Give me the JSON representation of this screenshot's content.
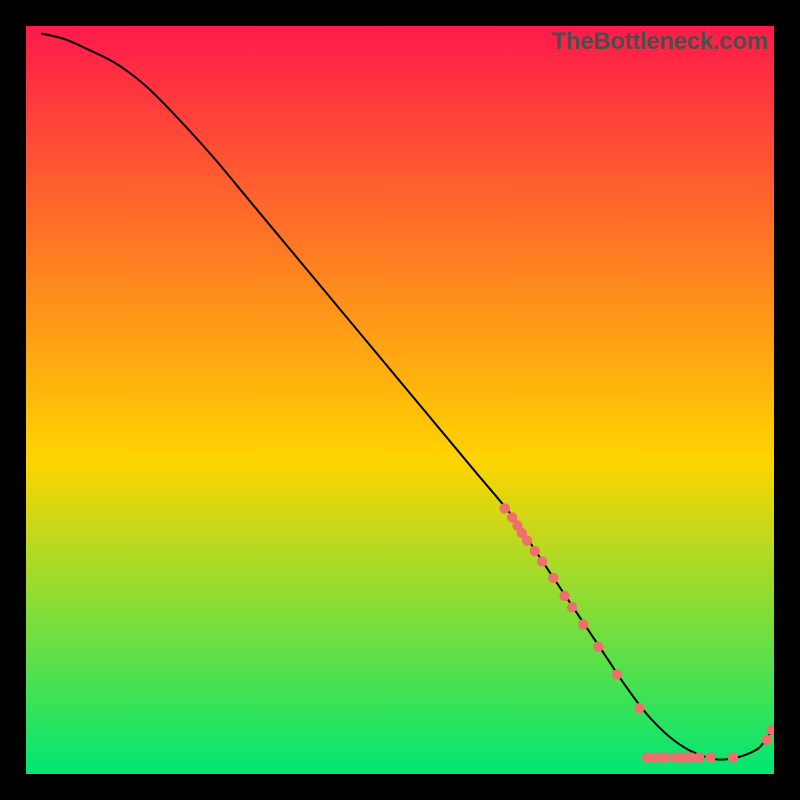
{
  "watermark": "TheBottleneck.com",
  "chart_data": {
    "type": "line",
    "title": "",
    "xlabel": "",
    "ylabel": "",
    "xlim": [
      0,
      100
    ],
    "ylim": [
      0,
      100
    ],
    "gradient_top": "#ff1a4a",
    "gradient_mid": "#ffd400",
    "gradient_bottom": "#00e673",
    "line_color": "#000000",
    "dot_color": "#ef6f6c",
    "series": [
      {
        "name": "curve",
        "x": [
          2,
          5,
          8,
          12,
          16,
          20,
          25,
          30,
          35,
          40,
          45,
          50,
          55,
          60,
          65,
          68,
          70,
          72,
          74,
          76,
          78,
          80,
          83,
          86,
          89,
          92,
          94,
          96,
          98,
          99.5
        ],
        "y": [
          99,
          98.3,
          97,
          95,
          92,
          88,
          82.5,
          76.5,
          70.5,
          64.5,
          58.5,
          52.5,
          46.5,
          40.5,
          34.5,
          30,
          27,
          24,
          21,
          18,
          15,
          12,
          8,
          5,
          3,
          2,
          2,
          2.5,
          3.5,
          5.5
        ]
      }
    ],
    "dots": [
      {
        "x": 64,
        "y": 35.5
      },
      {
        "x": 65,
        "y": 34.3
      },
      {
        "x": 65.7,
        "y": 33.2
      },
      {
        "x": 66.3,
        "y": 32.2
      },
      {
        "x": 67,
        "y": 31.2
      },
      {
        "x": 68,
        "y": 29.8
      },
      {
        "x": 69,
        "y": 28.4
      },
      {
        "x": 70.5,
        "y": 26.2
      },
      {
        "x": 72,
        "y": 23.8
      },
      {
        "x": 73,
        "y": 22.3
      },
      {
        "x": 74.5,
        "y": 20
      },
      {
        "x": 76.5,
        "y": 17
      },
      {
        "x": 79,
        "y": 13.3
      },
      {
        "x": 82,
        "y": 8.8
      },
      {
        "x": 83,
        "y": 2.2
      },
      {
        "x": 84,
        "y": 2.2
      },
      {
        "x": 84.8,
        "y": 2.2
      },
      {
        "x": 85.5,
        "y": 2.2
      },
      {
        "x": 86.7,
        "y": 2.2
      },
      {
        "x": 87.5,
        "y": 2.2
      },
      {
        "x": 88.3,
        "y": 2.2
      },
      {
        "x": 89,
        "y": 2.2
      },
      {
        "x": 90,
        "y": 2.2
      },
      {
        "x": 91.5,
        "y": 2.2
      },
      {
        "x": 94.5,
        "y": 2.2
      },
      {
        "x": 99,
        "y": 4.6
      },
      {
        "x": 99.7,
        "y": 5.9
      }
    ]
  }
}
